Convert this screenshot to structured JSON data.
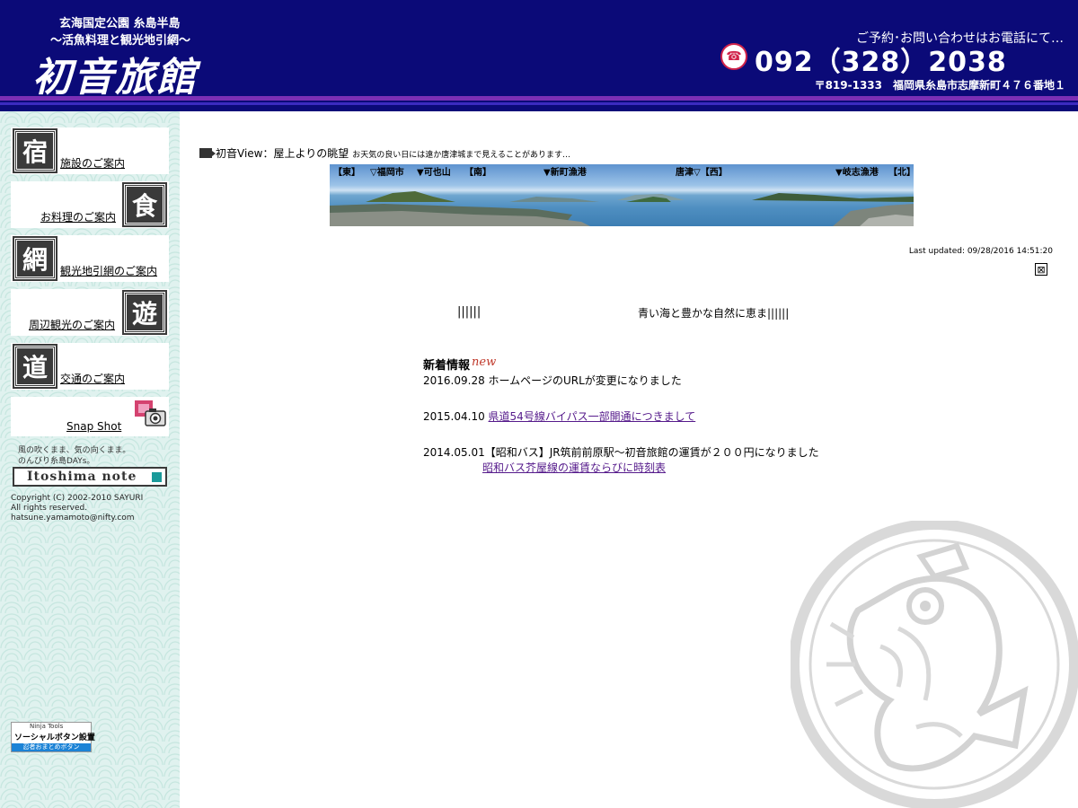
{
  "header": {
    "subtitle_1": "玄海国定公園 糸島半島",
    "subtitle_2": "〜活魚料理と観光地引網〜",
    "logo_text": "初音旅館",
    "contact_label": "ご予約･お問い合わせはお電話にて…",
    "phone_icon": "phone-icon",
    "phone": "092（328）2038",
    "address": "〒819-1333　福岡県糸島市志摩新町４７６番地１",
    "colors": {
      "background": "#0b0a78",
      "stripe": "#7b2fb5"
    }
  },
  "sidebar": {
    "nav": [
      {
        "kanji": "宿",
        "label": "施設のご案内"
      },
      {
        "kanji": "食",
        "label": "お料理のご案内"
      },
      {
        "kanji": "網",
        "label": "観光地引網のご案内"
      },
      {
        "kanji": "遊",
        "label": "周辺観光のご案内"
      },
      {
        "kanji": "道",
        "label": "交通のご案内"
      }
    ],
    "snapshot_label": "Snap Shot",
    "note_line1": "風の吹くまま、気の向くまま。",
    "note_line2": "のんびり糸島DAYs。",
    "itoshima_note": "Itoshima note",
    "copyright_line1": "Copyright (C) 2002-2010 SAYURI",
    "copyright_line2": "All rights reserved.",
    "copyright_line3": "hatsune.yamamoto@nifty.com",
    "ninja": {
      "line1": "Ninja Tools",
      "line2": "ソーシャルボタン設置",
      "line3": "忍者おまとめボタン"
    }
  },
  "main": {
    "view_title": "初音View：屋上よりの眺望",
    "view_note": "お天気の良い日には遠か唐津城まで見えることがあります…",
    "panorama_labels": {
      "east": "【東】",
      "fukuoka": "▽福岡市",
      "kaya": "▼可也山",
      "south": "【南】",
      "shinmachi": "▼新町漁港",
      "karatsu": "唐津▽【西】",
      "kishi": "▼岐志漁港",
      "north": "【北】"
    },
    "last_updated": "Last updated: 09/28/2016 14:51:20",
    "close_glyph": "⊠",
    "ticker_left": "||||||",
    "ticker_text": "青い海と豊かな自然に恵ま||||||",
    "news_title": "新着情報",
    "news_new_badge": "new",
    "news": [
      {
        "date": "2016.09.28",
        "text": "ホームページのURLが変更になりました",
        "link": ""
      },
      {
        "date": "2015.04.10",
        "text": "",
        "link": "県道54号線バイパス一部開通につきまして"
      },
      {
        "date": "2014.05.01",
        "text": "【昭和バス】JR筑前前原駅〜初音旅館の運賃が２００円になりました",
        "link": "昭和バス芥屋線の運賃ならびに時刻表"
      }
    ]
  }
}
